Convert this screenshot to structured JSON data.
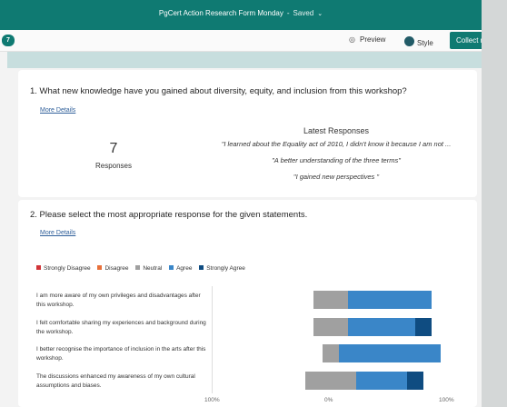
{
  "app": {
    "title": "PgCert Action Research Form Monday",
    "status": "Saved",
    "response_badge": "7"
  },
  "toolbar": {
    "preview_label": "Preview",
    "style_label": "Style",
    "collect_label": "Collect re"
  },
  "q1": {
    "title": "1. What new knowledge have you gained about diversity, equity, and inclusion from this workshop?",
    "more_details": "More Details",
    "count": "7",
    "count_label": "Responses",
    "latest_heading": "Latest Responses",
    "responses": [
      "\"I learned about the Equality act of 2010, I didn't know it because I am not ...",
      "\"A better understanding of the three terms\"",
      "\"I gained new perspectives \""
    ]
  },
  "q2": {
    "title": "2. Please select the most appropriate response for the given statements.",
    "more_details": "More Details",
    "legend": [
      {
        "label": "Strongly Disagree",
        "color": "#d13438"
      },
      {
        "label": "Disagree",
        "color": "#e8703a"
      },
      {
        "label": "Neutral",
        "color": "#a0a0a0"
      },
      {
        "label": "Agree",
        "color": "#3a86c8"
      },
      {
        "label": "Strongly Agree",
        "color": "#0f4c81"
      }
    ],
    "axis_labels": [
      "100%",
      "0%",
      "100%"
    ]
  },
  "chart_data": {
    "type": "bar",
    "categories": [
      "I am more aware of my own privileges and disadvantages after this workshop.",
      "I felt comfortable sharing my experiences and background during the workshop.",
      "I better recognise the importance of inclusion in the arts after this workshop.",
      "The discussions enhanced my awareness of my own cultural assumptions and biases."
    ],
    "series": [
      {
        "name": "Strongly Disagree",
        "values": [
          0,
          0,
          0,
          0
        ]
      },
      {
        "name": "Disagree",
        "values": [
          0,
          0,
          0,
          0
        ]
      },
      {
        "name": "Neutral",
        "values": [
          2,
          2,
          1,
          3
        ]
      },
      {
        "name": "Agree",
        "values": [
          5,
          4,
          6,
          3
        ]
      },
      {
        "name": "Strongly Agree",
        "values": [
          0,
          1,
          0,
          1
        ]
      }
    ],
    "xlabel": "",
    "ylabel": "",
    "xlim": [
      -100,
      100
    ]
  }
}
